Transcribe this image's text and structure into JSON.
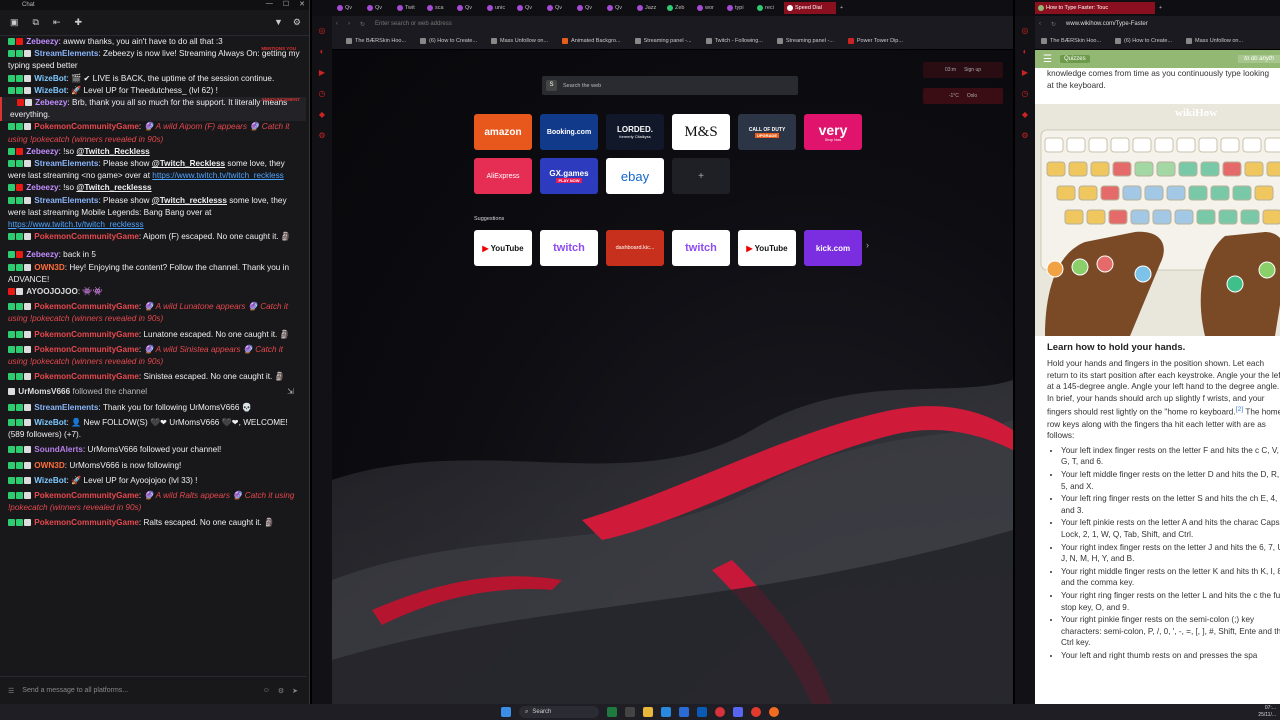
{
  "chat": {
    "window_title": "Chat",
    "input_placeholder": "Send a message to all platforms...",
    "tag_mention": "MENTIONS YOU",
    "tag_announcement": "ANNOUNCEMENT",
    "messages": [
      {
        "user": "Zebeezy",
        "text": "awww thanks, you ain't have to do all that :3"
      },
      {
        "user": "StreamElements",
        "text": "Zebeezy is now live! Streaming Always On: getting my typing speed better"
      },
      {
        "user": "WizeBot",
        "text": "🎬 ✔ LIVE is BACK, the uptime of the session continue."
      },
      {
        "user": "WizeBot",
        "text": "🚀 Level UP for Theedutchess_ (lvl 62) !"
      },
      {
        "user": "Zebeezy",
        "text": "Brb, thank you all so much for the support. It literally means everything."
      },
      {
        "user": "PokemonCommunityGame",
        "text": "🔮 A wild Aipom (F) appears 🔮 Catch it using !pokecatch (winners revealed in 90s)"
      },
      {
        "user": "Zebeezy",
        "text": "!so ",
        "mention": "@Twitch_Reckless"
      },
      {
        "user": "StreamElements",
        "text": "Please show ",
        "mention": "@Twitch_Reckless",
        "text2": " some love, they were last streaming <no game> over at ",
        "link": "https://www.twitch.tv/twitch_reckless"
      },
      {
        "user": "Zebeezy",
        "text": "!so ",
        "mention": "@Twitch_recklesss"
      },
      {
        "user": "StreamElements",
        "text": "Please show ",
        "mention": "@Twitch_recklesss",
        "text2": " some love, they were last streaming Mobile Legends: Bang Bang over at ",
        "link": "https://www.twitch.tv/twitch_recklesss"
      },
      {
        "user": "PokemonCommunityGame",
        "text": "Aipom (F) escaped. No one caught it. 🗿"
      },
      {
        "user": "Zebeezy",
        "text": "back in 5"
      },
      {
        "user": "OWN3D",
        "text": "Hey! Enjoying the content? Follow the channel. Thank you in ADVANCE!"
      },
      {
        "user": "AYOOJOJOO",
        "text": "👾👾"
      },
      {
        "user": "PokemonCommunityGame",
        "text": "🔮 A wild Lunatone appears 🔮 Catch it using !pokecatch (winners revealed in 90s)"
      },
      {
        "user": "PokemonCommunityGame",
        "text": "Lunatone escaped. No one caught it. 🗿"
      },
      {
        "user": "PokemonCommunityGame",
        "text": "🔮 A wild Sinistea appears 🔮 Catch it using !pokecatch (winners revealed in 90s)"
      },
      {
        "user": "PokemonCommunityGame",
        "text": "Sinistea escaped. No one caught it. 🗿"
      },
      {
        "user": "UrMomsV666",
        "text": "followed the channel"
      },
      {
        "user": "StreamElements",
        "text": "Thank you for following UrMomsV666 💀"
      },
      {
        "user": "WizeBot",
        "text": "👤 New FOLLOW(S) 🖤❤ UrMomsV666 🖤❤, WELCOME! (589 followers) (+7)."
      },
      {
        "user": "SoundAlerts",
        "text": "UrMomsV666 followed your channel!"
      },
      {
        "user": "OWN3D",
        "text": "UrMomsV666 is now following!"
      },
      {
        "user": "WizeBot",
        "text": "🚀 Level UP for Ayoojojoo (lvl 33) !"
      },
      {
        "user": "PokemonCommunityGame",
        "text": "🔮 A wild Ralts appears 🔮 Catch it using !pokecatch (winners revealed in 90s)"
      },
      {
        "user": "PokemonCommunityGame",
        "text": "Ralts escaped. No one caught it. 🗿"
      }
    ]
  },
  "browser": {
    "tabs": [
      "Qv",
      "Qv",
      "Twit",
      "sca",
      "Qv",
      "unic",
      "Qv",
      "Qv",
      "Qv",
      "Qv",
      "Jazz",
      "Zeb",
      "wor",
      "typi",
      "reci"
    ],
    "active_tab": "Speed Dial",
    "address_placeholder": "Enter search or web address",
    "bookmarks": [
      "The BÆRSkin Hoo...",
      "(6) How to Create...",
      "Mass Unfollow on...",
      "Animated Backgro...",
      "Streaming panel -...",
      "Twitch - Following...",
      "Streaming panel -...",
      "Power Tower Dip..."
    ],
    "search_placeholder": "Search the web",
    "dials": [
      "amazon",
      "Booking.com",
      "LORDED.",
      "M&S",
      "CALL OF DUTY",
      "very",
      "AliExpress",
      "GX.games",
      "ebay",
      "+"
    ],
    "dial_sub": {
      "lorded": "formerly Citalkyss",
      "very": "Shop Now",
      "gx": "PLAY NOW",
      "cod": "UPGRADE"
    },
    "suggestions_label": "Suggestions",
    "suggestions": [
      "YouTube",
      "twitch",
      "dashboard.kic...",
      "twitch",
      "YouTube",
      "kick.com"
    ],
    "widget1": [
      "03:m",
      "Sign up"
    ],
    "widget2": [
      "-1°C",
      "Oslo"
    ]
  },
  "wiki": {
    "tab_title": "How to Type Faster: Touc",
    "address": "www.wikihow.com/Type-Faster",
    "bookmarks": [
      "The BÆRSkin Hoo...",
      "(6) How to Create...",
      "Mass Unfollow on..."
    ],
    "top_btn": "Quizzes",
    "logo": "wikiHow",
    "search_placeholder": "to do anyth",
    "intro": "knowledge comes from time as you continuously type looking at the keyboard.",
    "heading": "Learn how to hold your hands.",
    "body": "Hold your hands and fingers in the position shown. Let each return to its start position after each keystroke. Angle your the left at a 145-degree angle. Angle your left hand to the degree angle. In brief, your hands should arch up slightly f wrists, and your fingers should rest lightly on the \"home ro keyboard.",
    "footnote": "[2]",
    "body2": " The home row keys along with the fingers tha hit each letter with are as follows:",
    "bullets": [
      "Your left index finger rests on the letter F and hits the c C, V, G, T, and 6.",
      "Your left middle finger rests on the letter D and hits the D, R, 5, and X.",
      "Your left ring finger rests on the letter S and hits the ch E, 4, and 3.",
      "Your left pinkie rests on the letter A and hits the charac Caps Lock, 2, 1, W, Q, Tab, Shift, and Ctrl.",
      "Your right index finger rests on the letter J and hits the 6, 7, U, J, N, M, H, Y, and B.",
      "Your right middle finger rests on the letter K and hits th K, I, 8, and the comma key.",
      "Your right ring finger rests on the letter L and hits the c the full stop key, O, and 9.",
      "Your right pinkie finger rests on the semi-colon (;) key characters: semi-colon, P, /, 0, ', -, =, [, ], #, Shift, Ente and the Ctrl key.",
      "Your left and right thumb rests on and presses the spa"
    ]
  },
  "taskbar": {
    "search": "Search",
    "time": "07:...",
    "date": "25/11/..."
  }
}
